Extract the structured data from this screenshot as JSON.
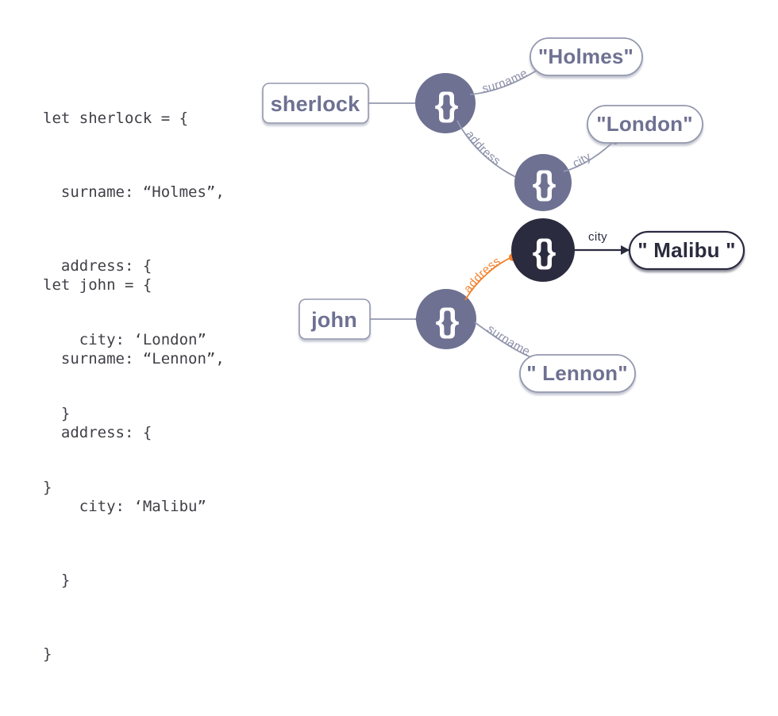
{
  "background": "#ffffff",
  "colors": {
    "code_text": "#3f3f46",
    "node_grey": "#6e7191",
    "node_dark": "#2b2b3f",
    "edge_grey": "#9498ae",
    "edge_dark": "#2b2b3f",
    "accent_orange": "#f4812c",
    "bubble_border_grey": "#9498ae",
    "bubble_border_dark": "#2b2b3f",
    "bubble_fill": "#ffffff"
  },
  "code": {
    "sherlock": {
      "lines": [
        "let sherlock = {",
        "  surname: “Holmes”,",
        "  address: {",
        "    city: ‘London”",
        "  }",
        "}"
      ]
    },
    "john": {
      "lines": [
        "let john = {",
        "  surname: “Lennon”,",
        "  address: {",
        "    city: ‘Malibu”",
        "  }",
        "}"
      ]
    }
  },
  "graphs": [
    {
      "id": "sherlock-graph",
      "variable_box": {
        "label": "sherlock"
      },
      "root_node": {
        "glyph": "{}"
      },
      "nested_node": {
        "glyph": "{}"
      },
      "edges": [
        {
          "label": "surname",
          "style": "grey",
          "from": "root-object-node",
          "to": "holmes-value"
        },
        {
          "label": "address",
          "style": "grey",
          "from": "root-object-node",
          "to": "nested-object-node"
        },
        {
          "label": "city",
          "style": "grey",
          "from": "nested-object-node",
          "to": "london-value"
        }
      ],
      "values": [
        {
          "id": "holmes-value",
          "label": "\"Holmes\"",
          "style": "grey"
        },
        {
          "id": "london-value",
          "label": "\"London\"",
          "style": "grey"
        }
      ]
    },
    {
      "id": "john-graph",
      "variable_box": {
        "label": "john"
      },
      "root_node": {
        "glyph": "{}"
      },
      "nested_node": {
        "glyph": "{}",
        "highlighted": true
      },
      "edges": [
        {
          "label": "address",
          "style": "accent",
          "from": "root-object-node",
          "to": "nested-object-node"
        },
        {
          "label": "surname",
          "style": "grey",
          "from": "root-object-node",
          "to": "lennon-value"
        },
        {
          "label": "city",
          "style": "dark",
          "from": "nested-object-node",
          "to": "malibu-value"
        }
      ],
      "values": [
        {
          "id": "malibu-value",
          "label": "\" Malibu \"",
          "style": "dark"
        },
        {
          "id": "lennon-value",
          "label": "\" Lennon\"",
          "style": "grey"
        }
      ]
    }
  ]
}
